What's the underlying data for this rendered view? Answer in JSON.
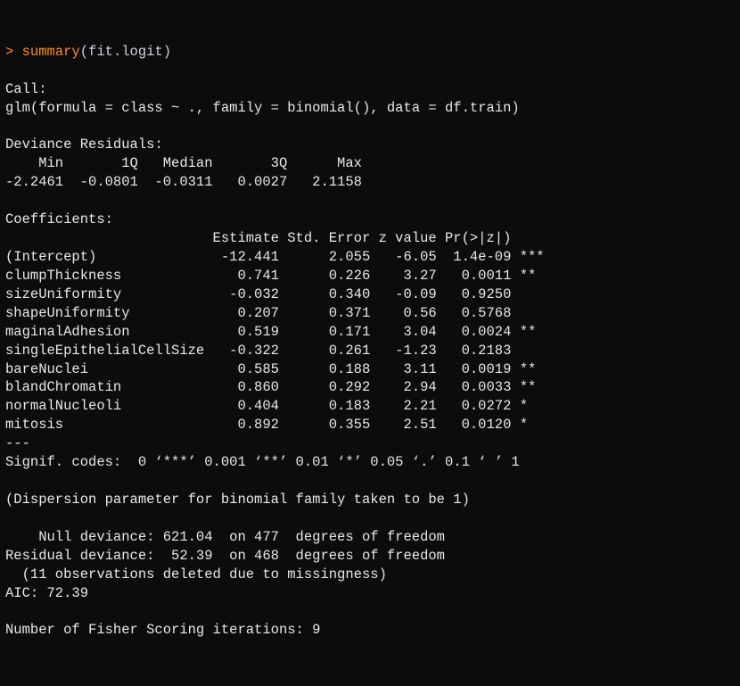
{
  "prompt": {
    "symbol": "> ",
    "fn": "summary",
    "open": "(",
    "arg": "fit.logit",
    "close": ")"
  },
  "callHeader": "Call:",
  "callLine": "glm(formula = class ~ ., family = binomial(), data = df.train)",
  "devResHeader": "Deviance Residuals:",
  "devResLabels": "    Min       1Q   Median       3Q      Max  ",
  "devResValues": "-2.2461  -0.0801  -0.0311   0.0027   2.1158  ",
  "coefHeader": "Coefficients:",
  "coefColHeader": "                         Estimate Std. Error z value Pr(>|z|)    ",
  "coefRows": [
    "(Intercept)               -12.441      2.055   -6.05  1.4e-09 ***",
    "clumpThickness              0.741      0.226    3.27   0.0011 ** ",
    "sizeUniformity             -0.032      0.340   -0.09   0.9250    ",
    "shapeUniformity             0.207      0.371    0.56   0.5768    ",
    "maginalAdhesion             0.519      0.171    3.04   0.0024 ** ",
    "singleEpithelialCellSize   -0.322      0.261   -1.23   0.2183    ",
    "bareNuclei                  0.585      0.188    3.11   0.0019 ** ",
    "blandChromatin              0.860      0.292    2.94   0.0033 ** ",
    "normalNucleoli              0.404      0.183    2.21   0.0272 *  ",
    "mitosis                     0.892      0.355    2.51   0.0120 *  "
  ],
  "dashLine": "---",
  "signifCodes": "Signif. codes:  0 ‘***’ 0.001 ‘**’ 0.01 ‘*’ 0.05 ‘.’ 0.1 ‘ ’ 1",
  "dispersion": "(Dispersion parameter for binomial family taken to be 1)",
  "nullDeviance": "    Null deviance: 621.04  on 477  degrees of freedom",
  "residDeviance": "Residual deviance:  52.39  on 468  degrees of freedom",
  "missingObs": "  (11 observations deleted due to missingness)",
  "aic": "AIC: 72.39",
  "fisher": "Number of Fisher Scoring iterations: 9",
  "chart_data": {
    "type": "table",
    "title": "glm logistic regression summary",
    "deviance_residuals": {
      "Min": -2.2461,
      "1Q": -0.0801,
      "Median": -0.0311,
      "3Q": 0.0027,
      "Max": 2.1158
    },
    "coefficients": [
      {
        "term": "(Intercept)",
        "estimate": -12.441,
        "std_error": 2.055,
        "z_value": -6.05,
        "p_value": 1.4e-09,
        "signif": "***"
      },
      {
        "term": "clumpThickness",
        "estimate": 0.741,
        "std_error": 0.226,
        "z_value": 3.27,
        "p_value": 0.0011,
        "signif": "**"
      },
      {
        "term": "sizeUniformity",
        "estimate": -0.032,
        "std_error": 0.34,
        "z_value": -0.09,
        "p_value": 0.925,
        "signif": ""
      },
      {
        "term": "shapeUniformity",
        "estimate": 0.207,
        "std_error": 0.371,
        "z_value": 0.56,
        "p_value": 0.5768,
        "signif": ""
      },
      {
        "term": "maginalAdhesion",
        "estimate": 0.519,
        "std_error": 0.171,
        "z_value": 3.04,
        "p_value": 0.0024,
        "signif": "**"
      },
      {
        "term": "singleEpithelialCellSize",
        "estimate": -0.322,
        "std_error": 0.261,
        "z_value": -1.23,
        "p_value": 0.2183,
        "signif": ""
      },
      {
        "term": "bareNuclei",
        "estimate": 0.585,
        "std_error": 0.188,
        "z_value": 3.11,
        "p_value": 0.0019,
        "signif": "**"
      },
      {
        "term": "blandChromatin",
        "estimate": 0.86,
        "std_error": 0.292,
        "z_value": 2.94,
        "p_value": 0.0033,
        "signif": "**"
      },
      {
        "term": "normalNucleoli",
        "estimate": 0.404,
        "std_error": 0.183,
        "z_value": 2.21,
        "p_value": 0.0272,
        "signif": "*"
      },
      {
        "term": "mitosis",
        "estimate": 0.892,
        "std_error": 0.355,
        "z_value": 2.51,
        "p_value": 0.012,
        "signif": "*"
      }
    ],
    "null_deviance": {
      "value": 621.04,
      "df": 477
    },
    "residual_deviance": {
      "value": 52.39,
      "df": 468
    },
    "observations_deleted": 11,
    "aic": 72.39,
    "fisher_iterations": 9
  }
}
